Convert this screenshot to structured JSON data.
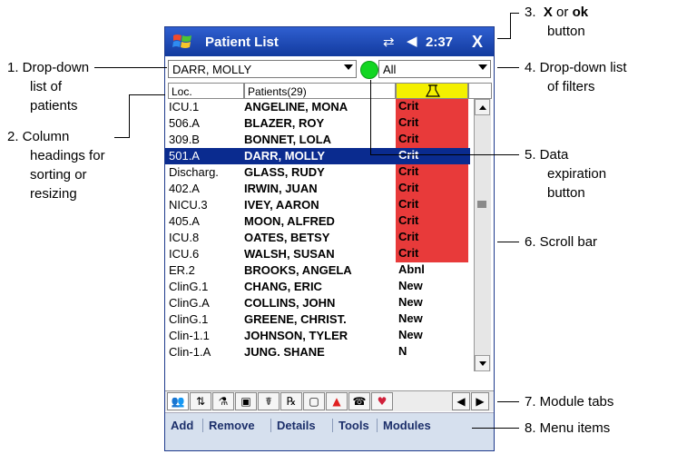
{
  "window": {
    "title": "Patient List",
    "time": "2:37",
    "close_label": "X"
  },
  "patient_dropdown": {
    "value": "DARR, MOLLY"
  },
  "filter_dropdown": {
    "value": "All"
  },
  "columns": {
    "loc": "Loc.",
    "patients": "Patients(29)"
  },
  "rows": [
    {
      "loc": "ICU.1",
      "name": "ANGELINE, MONA",
      "status": "Crit"
    },
    {
      "loc": "506.A",
      "name": "BLAZER, ROY",
      "status": "Crit"
    },
    {
      "loc": "309.B",
      "name": "BONNET, LOLA",
      "status": "Crit"
    },
    {
      "loc": "501.A",
      "name": "DARR, MOLLY",
      "status": "Crit"
    },
    {
      "loc": "Discharg.",
      "name": "GLASS, RUDY",
      "status": "Crit"
    },
    {
      "loc": "402.A",
      "name": "IRWIN, JUAN",
      "status": "Crit"
    },
    {
      "loc": "NICU.3",
      "name": "IVEY, AARON",
      "status": "Crit"
    },
    {
      "loc": "405.A",
      "name": "MOON, ALFRED",
      "status": "Crit"
    },
    {
      "loc": "ICU.8",
      "name": "OATES, BETSY",
      "status": "Crit"
    },
    {
      "loc": "ICU.6",
      "name": "WALSH, SUSAN",
      "status": "Crit"
    },
    {
      "loc": "ER.2",
      "name": "BROOKS, ANGELA",
      "status": "Abnl"
    },
    {
      "loc": "ClinG.1",
      "name": "CHANG, ERIC",
      "status": "New"
    },
    {
      "loc": "ClinG.A",
      "name": "COLLINS, JOHN",
      "status": "New"
    },
    {
      "loc": "ClinG.1",
      "name": "GREENE, CHRIST.",
      "status": "New"
    },
    {
      "loc": "Clin-1.1",
      "name": "JOHNSON, TYLER",
      "status": "New"
    },
    {
      "loc": "Clin-1.A",
      "name": "JUNG, SHANE",
      "status": "N"
    }
  ],
  "menu": {
    "add": "Add",
    "remove": "Remove",
    "details": "Details",
    "tools": "Tools",
    "modules": "Modules"
  },
  "colors": {
    "title_bar": "#1f4fc0",
    "selected_row": "#0a2b8f",
    "crit": "#e83a3a",
    "flask_header": "#f4f000",
    "green_button": "#12d622",
    "menu_bar": "#d6e0ee"
  },
  "tab_icons": [
    "patient-list-icon",
    "sort-icon",
    "flask-icon",
    "camera-icon",
    "doctor-icon",
    "medication-icon",
    "document-icon",
    "alert-triangle-icon",
    "phone-icon",
    "heart-icon"
  ],
  "annotations": {
    "a1_line1": "1.  Drop-down",
    "a1_line2": "list of",
    "a1_line3": "patients",
    "a2_line1": "2.  Column",
    "a2_line2": "headings for",
    "a2_line3": "sorting or",
    "a2_line4": "resizing",
    "a3_num": "3.",
    "a3_x": "X",
    "a3_or": "or",
    "a3_ok": "ok",
    "a3_line2": "button",
    "a4_line1": "4.  Drop-down list",
    "a4_line2": "of filters",
    "a5_line1": "5.  Data",
    "a5_line2": "expiration",
    "a5_line3": "button",
    "a6": "6.  Scroll bar",
    "a7": "7.  Module tabs",
    "a8": "8.  Menu items"
  }
}
